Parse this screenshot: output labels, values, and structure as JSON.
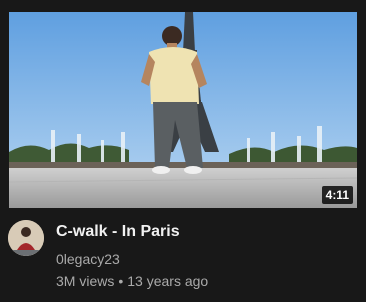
{
  "video": {
    "title": "C-walk - In Paris",
    "duration": "4:11",
    "channel": "0legacy23",
    "views": "3M views",
    "separator": "•",
    "age": "13 years ago"
  },
  "colors": {
    "background": "#181818",
    "title": "#f1f1f1",
    "secondary_text": "#aaaaaa",
    "sky": "#87b6e6"
  },
  "icons": {
    "avatar": "channel-avatar"
  }
}
